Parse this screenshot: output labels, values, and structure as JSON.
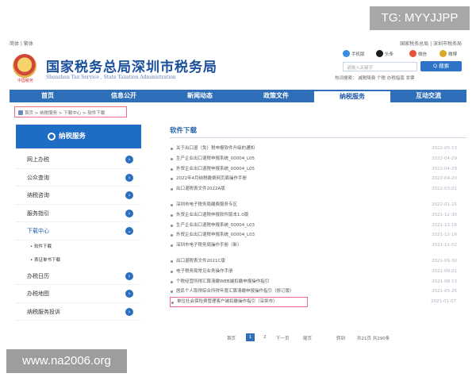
{
  "watermarks": {
    "tg": "TG: MYYJJPP",
    "site": "www.na2006.org"
  },
  "topbar": {
    "left": "简体 | 繁体",
    "right": "国家税务总局 | 深圳市税务局"
  },
  "header": {
    "title": "国家税务总局深圳市税务局",
    "subtitle": "Shenzhen Tax Service , State Taxation Administration",
    "emblem_caption": "中国税务"
  },
  "services": [
    {
      "label": "手机版",
      "color": "#3a8ee0"
    },
    {
      "label": "头条",
      "color": "#1d1d1d"
    },
    {
      "label": "微信",
      "color": "#e8503d"
    },
    {
      "label": "微博",
      "color": "#d9a826"
    }
  ],
  "search": {
    "placeholder": "请输入关键字",
    "button": "Q 搜索",
    "hotwords": "热词搜索：  减税降费  个税  办税指南  发票"
  },
  "nav": {
    "items": [
      "首页",
      "信息公开",
      "新闻动态",
      "政策文件",
      "纳税服务",
      "互动交流"
    ],
    "active_index": 4
  },
  "breadcrumb": "首页 > 纳税服务 > 下载中心 > 软件下载",
  "sidebar": {
    "title": "纳税服务",
    "items": [
      "网上办税",
      "公众查询",
      "纳税咨询",
      "服务指引",
      "下载中心"
    ],
    "active_index": 4,
    "sub_items": [
      "软件下载",
      "表证单书下载"
    ],
    "items_after": [
      "办税日历",
      "办税地图",
      "纳税服务投诉"
    ]
  },
  "content": {
    "title": "软件下载",
    "groups": [
      [
        {
          "text": "关于出口退（免）税申报软件升级的通知",
          "date": "2022-05-13"
        },
        {
          "text": "生产企业出口退税申报系统_00004_L05",
          "date": "2022-04-29"
        },
        {
          "text": "外贸企业出口退税申报系统_00004_L05",
          "date": "2022-04-29"
        },
        {
          "text": "2022年4月纳税缴费网页面操作手册",
          "date": "2022-04-20"
        },
        {
          "text": "出口退税表文件2022A版",
          "date": "2022-03-01"
        }
      ],
      [
        {
          "text": "深圳市电子税务局缴费服务专区",
          "date": "2022-01-25"
        },
        {
          "text": "外贸企业出口退税申报软件版本1.0版",
          "date": "2021-12-30"
        },
        {
          "text": "生产企业出口退税申报系统_00004_L03",
          "date": "2021-12-16"
        },
        {
          "text": "外贸企业出口退税申报系统_00004_L03",
          "date": "2021-12-16"
        },
        {
          "text": "深圳市电子税务局操作手册（新）",
          "date": "2021-11-02"
        }
      ],
      [
        {
          "text": "出口退税表文件2021C版",
          "date": "2021-09-30"
        },
        {
          "text": "电子税务局常见业务操作手册",
          "date": "2021-09-01"
        },
        {
          "text": "个税经营所得汇算清缴WEB端扣缴申报操作指引",
          "date": "2021-08-13"
        },
        {
          "text": "居民个人取得综合所得年度汇算清缴申报操作指引（修订版）",
          "date": "2021-05-26"
        },
        {
          "text": "单位社会保险费管理客户端扣缴操作指引（深圳市）",
          "date": "2021-01-07",
          "highlight": true
        }
      ]
    ]
  },
  "pager": {
    "first": "首页",
    "current": "1",
    "page2": "2",
    "next": "下一页",
    "last": "尾页",
    "goto": "转到",
    "summary": "共21页 共290条"
  }
}
